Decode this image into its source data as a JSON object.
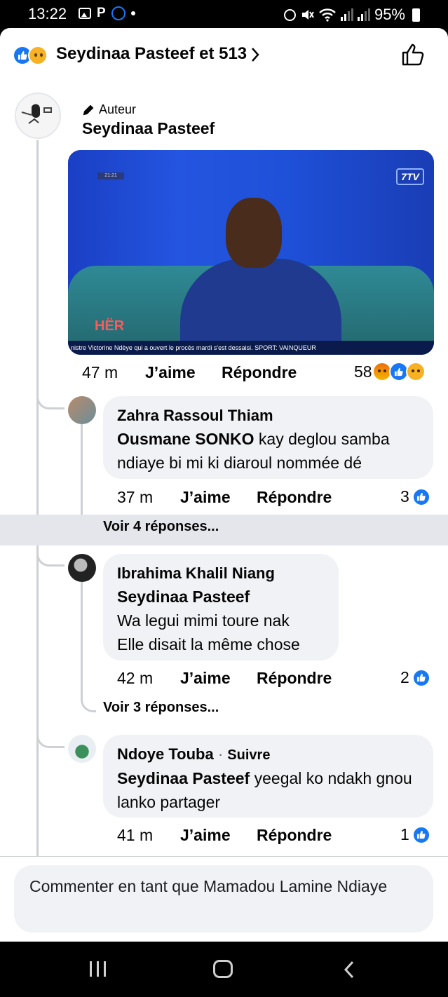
{
  "status_bar": {
    "time": "13:22",
    "left_icons": [
      "image-icon",
      "p-icon",
      "call-icon",
      "dot-icon"
    ],
    "right_icons": [
      "alarm-icon",
      "mute-icon",
      "wifi-icon",
      "signal-icon",
      "signal-icon"
    ],
    "battery": "95%"
  },
  "header": {
    "title": "Seydinaa Pasteef et 513",
    "reaction_icons": [
      "like-icon",
      "sad-icon"
    ],
    "chevron": "chevron-right-icon",
    "like_button_icon": "thumbs-up-outline-icon"
  },
  "post": {
    "badge": "Auteur",
    "badge_icon": "pencil-icon",
    "author": "Seydinaa Pasteef",
    "video": {
      "clock": "21:21",
      "channel_logo": "7TV",
      "show_label": "HËR",
      "ticker": "nistre Victorine Ndèye qui a ouvert le procès mardi s'est dessaisi. SPORT: VAINQUEUR"
    },
    "time": "47 m",
    "like_label": "J’aime",
    "reply_label": "Répondre",
    "reaction_count": "58",
    "reactions": [
      "angry-icon",
      "like-icon",
      "sad-icon"
    ]
  },
  "comments": [
    {
      "author": "Zahra Rassoul Thiam",
      "tag": "Ousmane SONKO",
      "text": " kay deglou samba ndiaye bi mi ki diaroul nommée dé",
      "time": "37 m",
      "like_label": "J’aime",
      "reply_label": "Répondre",
      "like_count": "3",
      "replies_link": "Voir 4 réponses..."
    },
    {
      "author": "Ibrahima Khalil Niang",
      "tag": "Seydinaa Pasteef",
      "text_line1": "Wa legui mimi toure nak",
      "text_line2": "Elle disait la même chose",
      "time": "42 m",
      "like_label": "J’aime",
      "reply_label": "Répondre",
      "like_count": "2",
      "replies_link": "Voir 3 réponses..."
    },
    {
      "author": "Ndoye Touba",
      "follow_separator": "·",
      "follow_label": "Suivre",
      "tag": "Seydinaa Pasteef",
      "text": " yeegal ko ndakh gnou lanko partager",
      "time": "41 m",
      "like_label": "J’aime",
      "reply_label": "Répondre",
      "like_count": "1"
    }
  ],
  "composer": {
    "placeholder": "Commenter en tant que Mamadou Lamine Ndiaye"
  },
  "nav_bar": {
    "buttons": [
      "recents-icon",
      "home-icon",
      "back-icon"
    ]
  },
  "colors": {
    "accent": "#1877f2",
    "bubble": "#f0f2f5",
    "thread_line": "#ced0d4"
  }
}
